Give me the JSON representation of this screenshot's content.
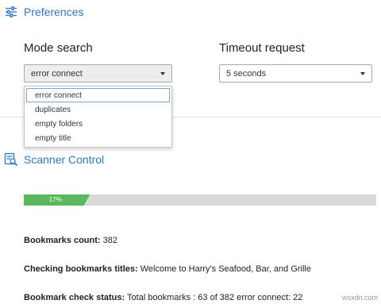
{
  "preferences": {
    "title": "Preferences",
    "icon": "sliders-icon",
    "mode_search": {
      "label": "Mode search",
      "value": "error connect",
      "options": [
        "error connect",
        "duplicates",
        "empty folders",
        "empty title"
      ]
    },
    "timeout_request": {
      "label": "Timeout request",
      "value": "5 seconds"
    }
  },
  "scanner": {
    "title": "Scanner Control",
    "icon": "scan-document-icon",
    "progress_percent": 17,
    "progress_label": "17%",
    "progress_color": "#5cb85c",
    "stats": {
      "count_label": "Bookmarks count:",
      "count_value": "382",
      "checking_label": "Checking bookmarks titles:",
      "checking_value": "Welcome to Harry's Seafood, Bar, and Grille",
      "status_label": "Bookmark check status:",
      "status_value": "Total bookmarks : 63 of 382 error connect: 22"
    }
  },
  "watermark": "wsxdn.com",
  "colors": {
    "accent": "#2d78c9"
  }
}
